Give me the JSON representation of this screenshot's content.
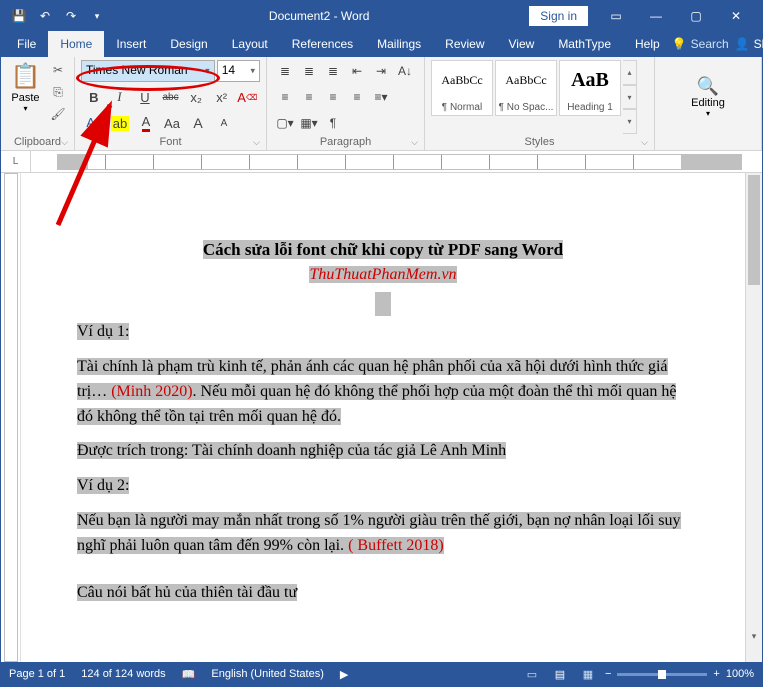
{
  "titlebar": {
    "title": "Document2 - Word",
    "signin": "Sign in"
  },
  "tabs": {
    "file": "File",
    "home": "Home",
    "insert": "Insert",
    "design": "Design",
    "layout": "Layout",
    "references": "References",
    "mailings": "Mailings",
    "review": "Review",
    "view": "View",
    "mathtype": "MathType",
    "help": "Help",
    "tellme": "Search",
    "share": "Share"
  },
  "ribbon": {
    "clipboard": {
      "label": "Clipboard",
      "paste": "Paste"
    },
    "font": {
      "label": "Font",
      "name": "Times New Roman",
      "size": "14",
      "bold": "B",
      "italic": "I",
      "underline": "U",
      "strike": "abc",
      "sub": "x₂",
      "sup": "x²",
      "clear": "A",
      "highlight": "ab",
      "color": "A",
      "case": "Aa",
      "grow": "A",
      "shrink": "A"
    },
    "para": {
      "label": "Paragraph"
    },
    "styles": {
      "label": "Styles",
      "items": [
        {
          "preview": "AaBbCc",
          "name": "¶ Normal"
        },
        {
          "preview": "AaBbCc",
          "name": "¶ No Spac..."
        },
        {
          "preview": "AaB",
          "name": "Heading 1"
        }
      ]
    },
    "editing": {
      "label": "Editing"
    }
  },
  "doc": {
    "title": "Cách sửa lỗi font chữ khi copy từ PDF sang Word",
    "subtitle": "ThuThuatPhanMem.vn",
    "ex1_label": "Ví dụ 1:",
    "p1a": "Tài chính là phạm trù kinh tế, phản ánh các quan hệ phân phối của xã hội dưới hình thức giá trị… ",
    "p1cite": "(Minh 2020)",
    "p1b": ". Nếu mỗi quan hệ đó không thể phối hợp của một đoàn thể thì mối quan hệ đó không thể tồn tại trên mối quan hệ đó.",
    "p2": "Được trích trong: Tài chính doanh nghiệp của tác giả Lê Anh Minh",
    "ex2_label": "Ví dụ 2:",
    "p3a": "Nếu bạn là người may mắn nhất trong số 1% người giàu trên thế giới, bạn nợ nhân loại lối suy nghĩ phải luôn quan tâm đến 99% còn lại. ",
    "p3cite": "( Buffett 2018)",
    "p4": "Câu nói bất hủ của thiên tài đầu tư"
  },
  "status": {
    "page": "Page 1 of 1",
    "words": "124 of 124 words",
    "lang": "English (United States)",
    "zoom": "100%"
  }
}
